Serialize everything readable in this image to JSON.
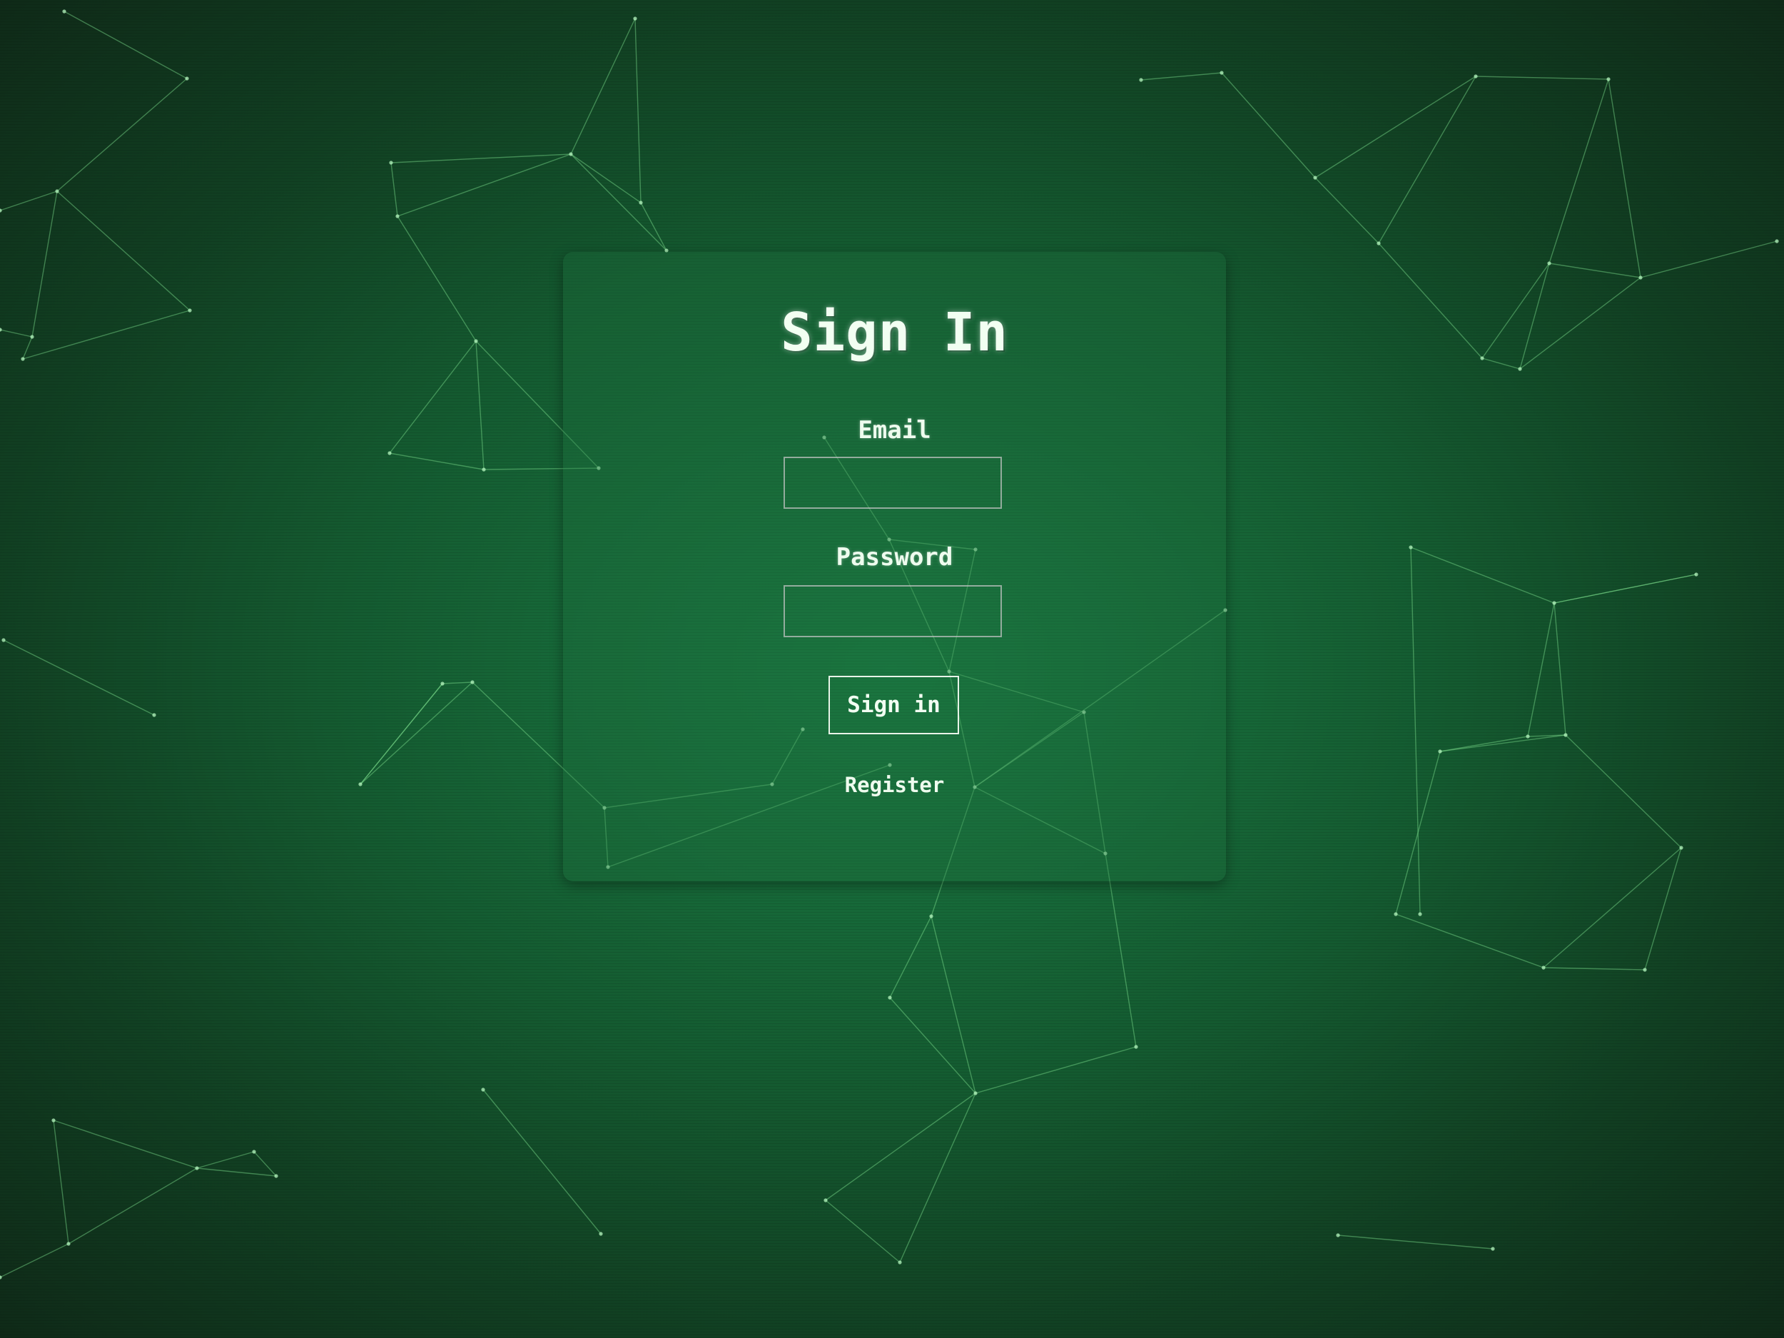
{
  "form": {
    "title": "Sign In",
    "email_label": "Email",
    "email_value": "",
    "password_label": "Password",
    "password_value": "",
    "signin_label": "Sign in",
    "register_label": "Register"
  },
  "theme": {
    "background": "#176b3a",
    "accent": "#7fe08f",
    "text": "#f2fff2"
  },
  "background_graphic": {
    "icon": "constellation-network"
  }
}
